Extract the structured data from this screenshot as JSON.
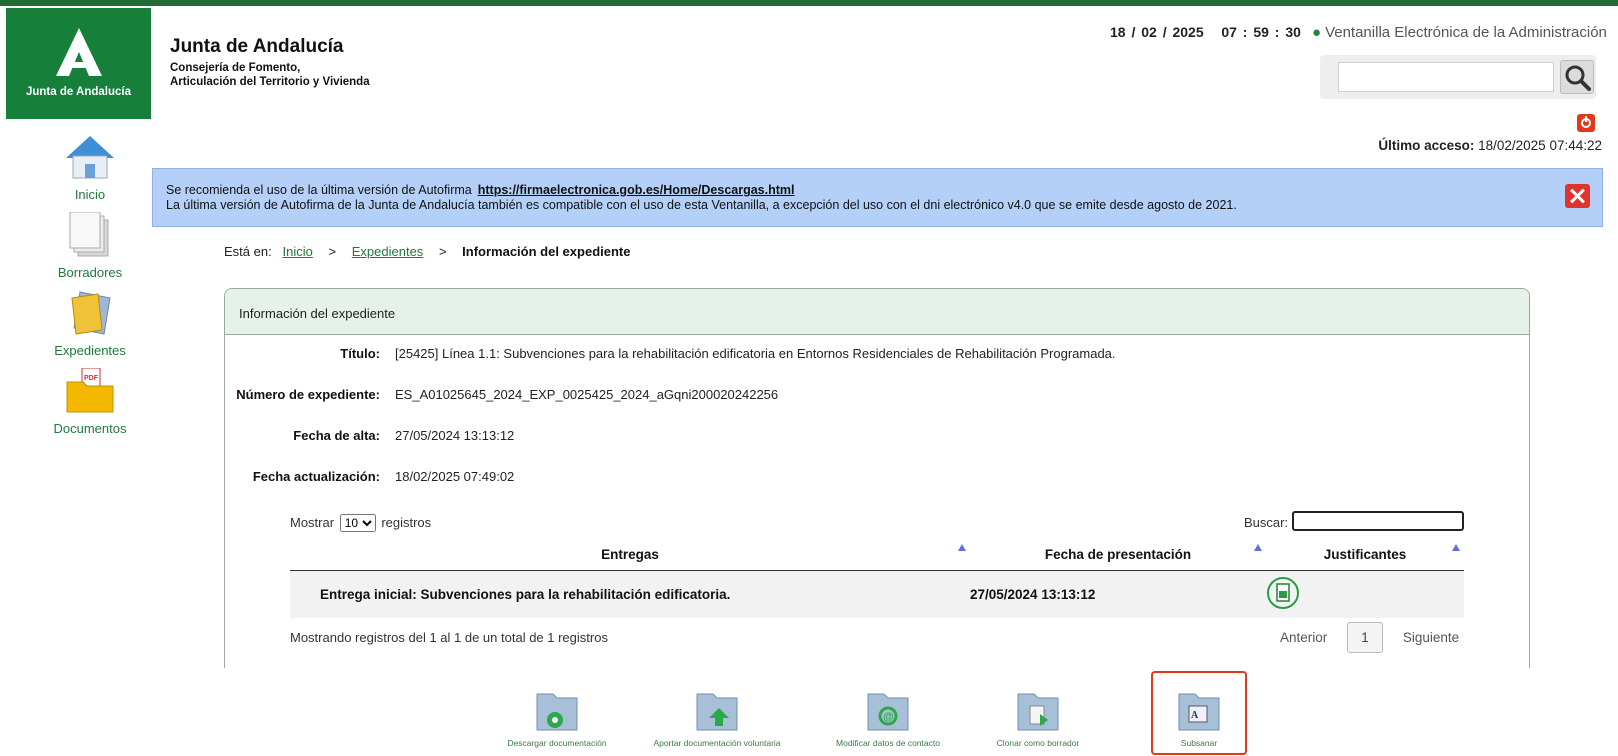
{
  "header": {
    "logo_text": "Junta de Andalucía",
    "org_title": "Junta de Andalucía",
    "org_sub_1": "Consejería de Fomento,",
    "org_sub_2": "Articulación del Territorio y Vivienda",
    "date": "18 / 02 / 2025",
    "time": "07 : 59 : 30",
    "ventanilla": "Ventanilla Electrónica de la Administración",
    "search_placeholder": "",
    "last_access_label": "Último acceso:",
    "last_access_value": "18/02/2025 07:44:22"
  },
  "sidebar": {
    "items": [
      {
        "label": "Inicio",
        "icon": "home-icon"
      },
      {
        "label": "Borradores",
        "icon": "drafts-icon"
      },
      {
        "label": "Expedientes",
        "icon": "folders-icon"
      },
      {
        "label": "Documentos",
        "icon": "pdf-folder-icon"
      }
    ]
  },
  "notice": {
    "line1": "Se recomienda el uso de la última versión de Autofirma",
    "link": "https://firmaelectronica.gob.es/Home/Descargas.html",
    "line2": "La última versión de Autofirma de la Junta de Andalucía también es compatible con el uso de esta Ventanilla, a excepción del uso con el dni electrónico v4.0 que se emite desde agosto de 2021."
  },
  "breadcrumb": {
    "prefix": "Está en:",
    "home": "Inicio",
    "sep": ">",
    "expedientes": "Expedientes",
    "current": "Información del expediente"
  },
  "panel": {
    "title": "Información del expediente",
    "fields": [
      {
        "label": "Título:",
        "value": "[25425] Línea 1.1: Subvenciones para la rehabilitación edificatoria en Entornos Residenciales de Rehabilitación Programada."
      },
      {
        "label": "Número de expediente:",
        "value": "ES_A01025645_2024_EXP_0025425_2024_aGqni200020242256"
      },
      {
        "label": "Fecha de alta:",
        "value": "27/05/2024 13:13:12"
      },
      {
        "label": "Fecha actualización:",
        "value": "18/02/2025 07:49:02"
      }
    ]
  },
  "table": {
    "show_prefix": "Mostrar",
    "show_value": "10",
    "show_suffix": "registros",
    "search_label": "Buscar:",
    "columns": [
      "Entregas",
      "Fecha de presentación",
      "Justificantes"
    ],
    "rows": [
      {
        "entrega": "Entrega inicial: Subvenciones para la rehabilitación edificatoria.",
        "fecha": "27/05/2024 13:13:12",
        "justificante_icon": "receipt-download-icon"
      }
    ],
    "info": "Mostrando registros del 1 al 1 de un total de 1 registros",
    "prev": "Anterior",
    "page": "1",
    "next": "Siguiente"
  },
  "actions": [
    {
      "label": "Descargar documentación",
      "icon": "download-folder-icon"
    },
    {
      "label": "Aportar documentación voluntaria",
      "icon": "upload-folder-icon"
    },
    {
      "label": "Modificar datos de contacto",
      "icon": "contact-folder-icon"
    },
    {
      "label": "Clonar como borrador",
      "icon": "clone-folder-icon"
    },
    {
      "label": "Subsanar",
      "icon": "subsanar-folder-icon",
      "selected": true
    }
  ],
  "colors": {
    "brand_green": "#167f3a",
    "notice_blue": "#b4d0f9",
    "highlight_red": "#e03a1a"
  }
}
